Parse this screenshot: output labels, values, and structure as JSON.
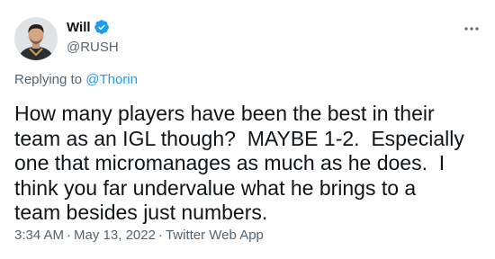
{
  "author": {
    "display_name": "Will",
    "handle": "@RUSH",
    "verified": true
  },
  "reply": {
    "prefix": "Replying to ",
    "mention": "@Thorin"
  },
  "tweet": {
    "text": "How many players have been the best in their team as an IGL though?  MAYBE 1-2.  Especially one that micromanages as much as he does.  I think you far undervalue what he brings to a team besides just numbers.",
    "time": "3:34 AM",
    "separator": "·",
    "date": "May 13, 2022",
    "source": "Twitter Web App"
  },
  "icons": {
    "verified": "verified-badge-icon",
    "more": "more-options-icon"
  },
  "colors": {
    "accent": "#1d9bf0",
    "secondary_text": "#536471",
    "primary_text": "#0f1419"
  }
}
